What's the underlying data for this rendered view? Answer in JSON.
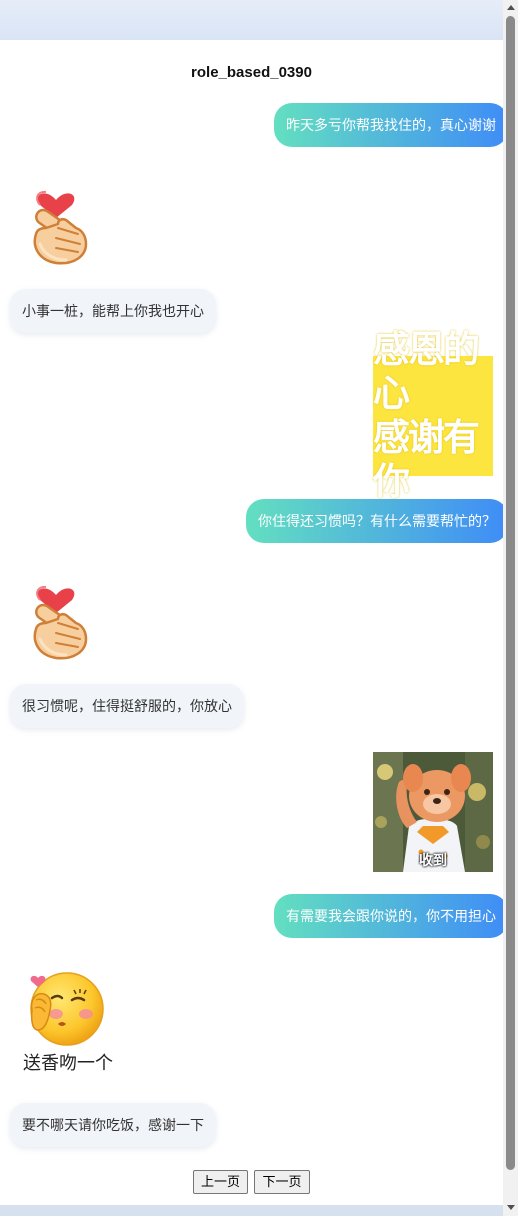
{
  "page": {
    "title": "role_based_0390"
  },
  "messages": [
    {
      "role": "user",
      "kind": "text",
      "text": "昨天多亏你帮我找住的，真心谢谢"
    },
    {
      "role": "bot",
      "kind": "sticker",
      "sticker": "finger-heart-icon"
    },
    {
      "role": "bot",
      "kind": "text",
      "text": "小事一桩，能帮上你我也开心"
    },
    {
      "role": "user",
      "kind": "sticker",
      "sticker": "gratitude-poster",
      "lines": [
        "感恩的心",
        "感谢有你"
      ]
    },
    {
      "role": "user",
      "kind": "text",
      "text": "你住得还习惯吗？有什么需要帮忙的？"
    },
    {
      "role": "bot",
      "kind": "sticker",
      "sticker": "finger-heart-icon"
    },
    {
      "role": "bot",
      "kind": "text",
      "text": "很习惯呢，住得挺舒服的，你放心"
    },
    {
      "role": "user",
      "kind": "sticker",
      "sticker": "mascot-photo",
      "caption": "收到"
    },
    {
      "role": "user",
      "kind": "text",
      "text": "有需要我会跟你说的，你不用担心"
    },
    {
      "role": "bot",
      "kind": "sticker",
      "sticker": "kiss-face-icon",
      "caption": "送香吻一个"
    },
    {
      "role": "bot",
      "kind": "text",
      "text": "要不哪天请你吃饭，感谢一下"
    }
  ],
  "pagination": {
    "prev_label": "上一页",
    "next_label": "下一页"
  },
  "colors": {
    "user_bubble_start": "#63dfc0",
    "user_bubble_end": "#3f8cf7",
    "bot_bubble": "#f1f4f9",
    "poster_bg": "#fde53f"
  }
}
